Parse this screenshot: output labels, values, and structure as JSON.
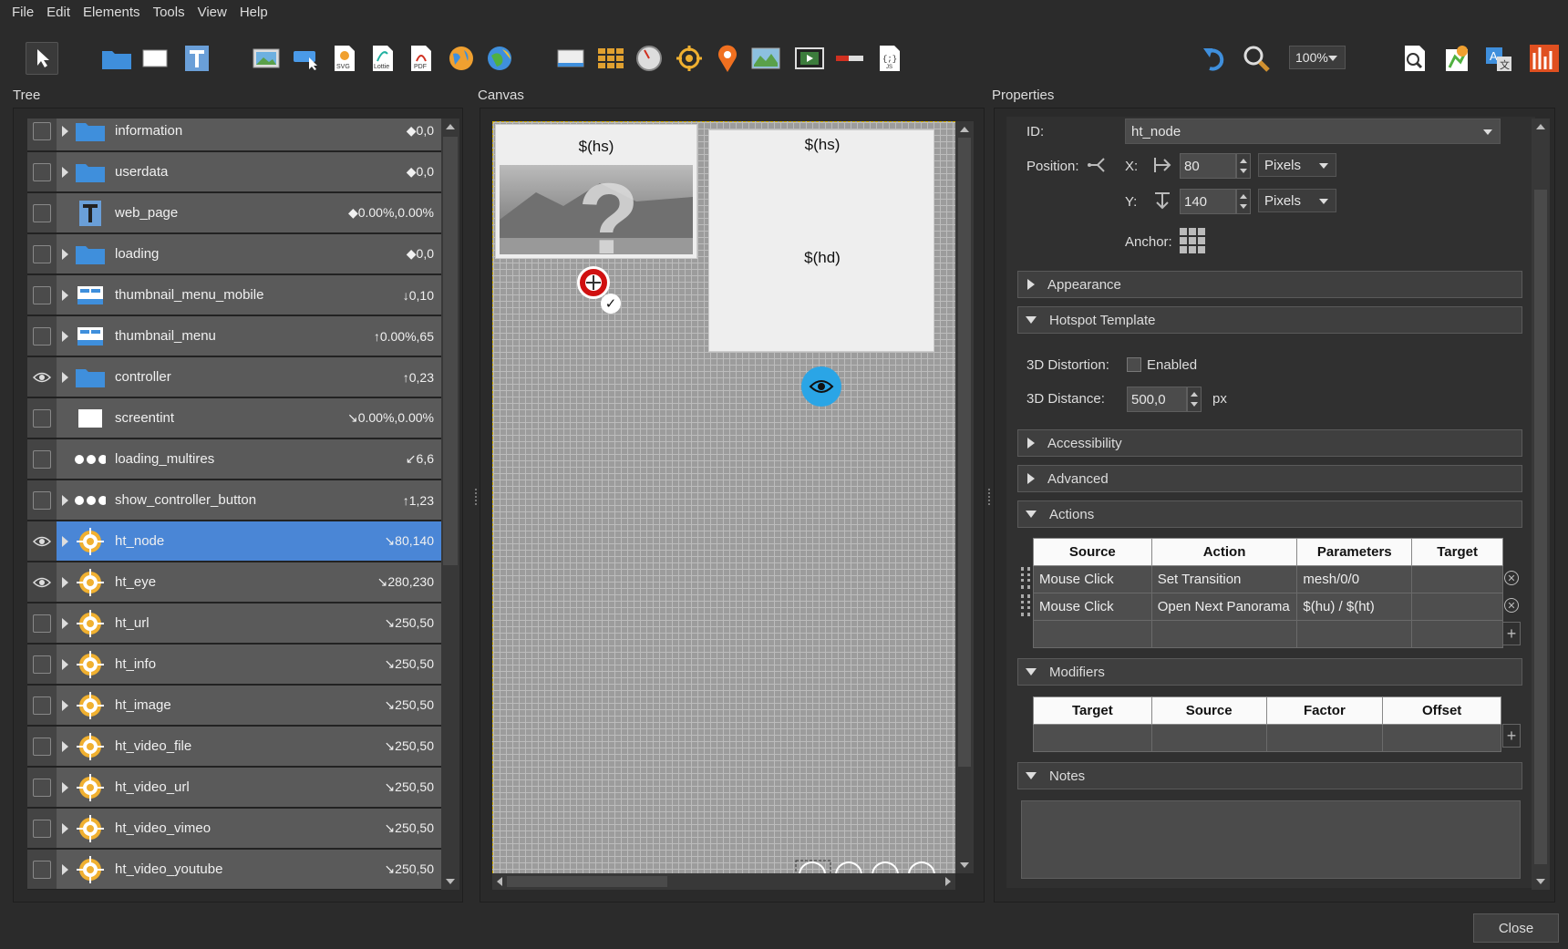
{
  "menu": [
    "File",
    "Edit",
    "Elements",
    "Tools",
    "View",
    "Help"
  ],
  "toolbar": {
    "zoom": "100%"
  },
  "panels": {
    "tree": "Tree",
    "canvas": "Canvas",
    "properties": "Properties"
  },
  "tree_rows": [
    {
      "name": "information",
      "pos": "◆0,0",
      "icon": "folder-icon",
      "arrow": true,
      "vis": "check"
    },
    {
      "name": "userdata",
      "pos": "◆0,0",
      "icon": "folder-icon",
      "arrow": true,
      "vis": "check"
    },
    {
      "name": "web_page",
      "pos": "◆0.00%,0.00%",
      "icon": "text-icon",
      "arrow": false,
      "vis": "check"
    },
    {
      "name": "loading",
      "pos": "◆0,0",
      "icon": "folder-icon",
      "arrow": true,
      "vis": "check"
    },
    {
      "name": "thumbnail_menu_mobile",
      "pos": "↓0,10",
      "icon": "container-icon",
      "arrow": true,
      "vis": "check"
    },
    {
      "name": "thumbnail_menu",
      "pos": "↑0.00%,65",
      "icon": "container-icon",
      "arrow": true,
      "vis": "check"
    },
    {
      "name": "controller",
      "pos": "↑0,23",
      "icon": "folder-icon",
      "arrow": true,
      "vis": "eye"
    },
    {
      "name": "screentint",
      "pos": "↘0.00%,0.00%",
      "icon": "rectangle-icon",
      "arrow": false,
      "vis": "check"
    },
    {
      "name": "loading_multires",
      "pos": "↙6,6",
      "icon": "dots-icon",
      "arrow": false,
      "vis": "check"
    },
    {
      "name": "show_controller_button",
      "pos": "↑1,23",
      "icon": "dots-icon",
      "arrow": true,
      "vis": "check"
    },
    {
      "name": "ht_node",
      "pos": "↘80,140",
      "icon": "hotspot-icon",
      "arrow": true,
      "vis": "eye",
      "selected": true
    },
    {
      "name": "ht_eye",
      "pos": "↘280,230",
      "icon": "hotspot-icon",
      "arrow": true,
      "vis": "eye"
    },
    {
      "name": "ht_url",
      "pos": "↘250,50",
      "icon": "hotspot-icon",
      "arrow": true,
      "vis": "check"
    },
    {
      "name": "ht_info",
      "pos": "↘250,50",
      "icon": "hotspot-icon",
      "arrow": true,
      "vis": "check"
    },
    {
      "name": "ht_image",
      "pos": "↘250,50",
      "icon": "hotspot-icon",
      "arrow": true,
      "vis": "check"
    },
    {
      "name": "ht_video_file",
      "pos": "↘250,50",
      "icon": "hotspot-icon",
      "arrow": true,
      "vis": "check"
    },
    {
      "name": "ht_video_url",
      "pos": "↘250,50",
      "icon": "hotspot-icon",
      "arrow": true,
      "vis": "check"
    },
    {
      "name": "ht_video_vimeo",
      "pos": "↘250,50",
      "icon": "hotspot-icon",
      "arrow": true,
      "vis": "check"
    },
    {
      "name": "ht_video_youtube",
      "pos": "↘250,50",
      "icon": "hotspot-icon",
      "arrow": true,
      "vis": "check"
    }
  ],
  "canvas": {
    "hs1": "$(hs)",
    "hs2": "$(hs)",
    "hd": "$(hd)"
  },
  "props": {
    "id_label": "ID:",
    "id_value": "ht_node",
    "position_label": "Position:",
    "x_label": "X:",
    "x_value": "80",
    "y_label": "Y:",
    "y_value": "140",
    "unit_x": "Pixels",
    "unit_y": "Pixels",
    "anchor_label": "Anchor:",
    "sections": {
      "appearance": "Appearance",
      "hotspot_template": "Hotspot Template",
      "accessibility": "Accessibility",
      "advanced": "Advanced",
      "actions": "Actions",
      "modifiers": "Modifiers",
      "notes": "Notes"
    },
    "distortion_label": "3D Distortion:",
    "distortion_enabled": "Enabled",
    "distance_label": "3D Distance:",
    "distance_value": "500,0",
    "distance_unit": "px",
    "actions_headers": [
      "Source",
      "Action",
      "Parameters",
      "Target"
    ],
    "actions_rows": [
      [
        "Mouse Click",
        "Set Transition",
        "mesh/0/0",
        ""
      ],
      [
        "Mouse Click",
        "Open Next Panorama",
        "$(hu) / $(ht)",
        ""
      ]
    ],
    "modifiers_headers": [
      "Target",
      "Source",
      "Factor",
      "Offset"
    ]
  },
  "close_label": "Close"
}
